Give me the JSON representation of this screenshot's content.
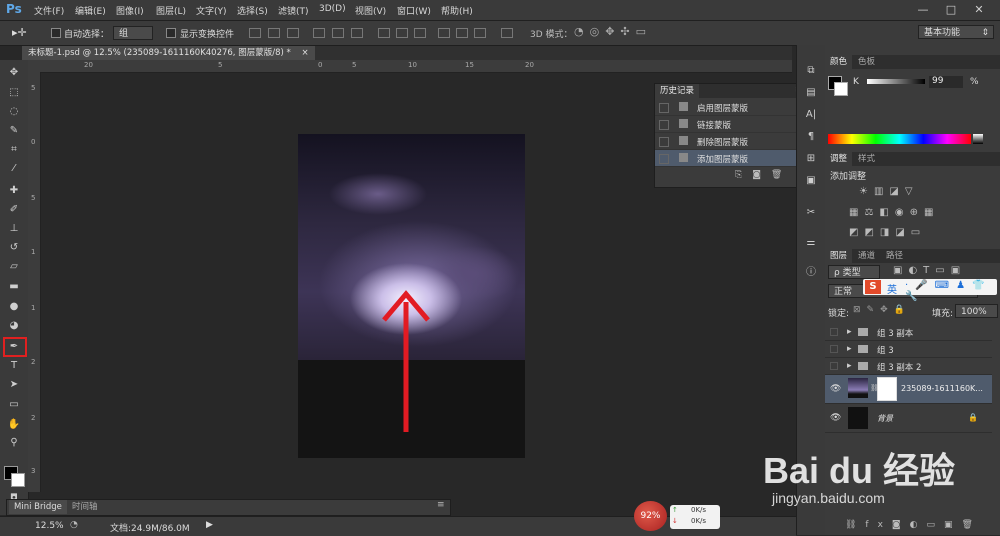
{
  "app": {
    "logo": "Ps"
  },
  "menu": [
    "文件(F)",
    "编辑(E)",
    "图像(I)",
    "图层(L)",
    "文字(Y)",
    "选择(S)",
    "滤镜(T)",
    "3D(D)",
    "视图(V)",
    "窗口(W)",
    "帮助(H)"
  ],
  "window_controls": {
    "minimize": "—",
    "maximize": "□",
    "close": "✕"
  },
  "options": {
    "auto_select_label": "自动选择：",
    "auto_select_value": "组",
    "show_transform_label": "显示变换控件",
    "mode_3d_label": "3D 模式：",
    "workspace": "基本功能"
  },
  "document": {
    "tab_title": "未标题-1.psd @ 12.5% (235089-1611160K40276, 图层蒙版/8) *",
    "close": "×"
  },
  "rulers": {
    "top": [
      "20",
      "5",
      "0",
      "5",
      "10",
      "15",
      "20"
    ],
    "left": [
      "5",
      "0",
      "5",
      "1",
      "1",
      "2",
      "2",
      "3"
    ]
  },
  "history": {
    "title": "历史记录",
    "items": [
      "启用图层蒙版",
      "链接蒙版",
      "删除图层蒙版",
      "添加图层蒙版"
    ]
  },
  "color_panel": {
    "tabs": [
      "颜色",
      "色板"
    ],
    "channel": "K",
    "value": "99",
    "unit": "%"
  },
  "adjust_panel": {
    "tabs": [
      "调整",
      "样式"
    ],
    "heading": "添加调整"
  },
  "layers_panel": {
    "tabs": [
      "图层",
      "通道",
      "路径"
    ],
    "filter": "ρ 类型",
    "blend_mode": "正常",
    "lock_label": "锁定:",
    "fill_label": "填充:",
    "fill_value": "100%",
    "layers": [
      {
        "name": "组 3 副本"
      },
      {
        "name": "组 3"
      },
      {
        "name": "组 3 副本 2"
      },
      {
        "name": "235089-1611160K..."
      },
      {
        "name": "背景"
      }
    ]
  },
  "ime_toolbar": {
    "logo": "S",
    "mode": "英"
  },
  "minibridge": {
    "tabs": [
      "Mini Bridge",
      "时间轴"
    ]
  },
  "status": {
    "zoom": "12.5%",
    "doc_size": "文档:24.9M/86.0M"
  },
  "net_widget": {
    "percent": "92%",
    "up": "0K/s",
    "down": "0K/s"
  },
  "watermark": {
    "brand": "Bai du 经验",
    "url": "jingyan.baidu.com"
  },
  "colors": {
    "highlight": "#e02020",
    "arrow": "#e21b23",
    "accent": "#5fa8e8"
  }
}
